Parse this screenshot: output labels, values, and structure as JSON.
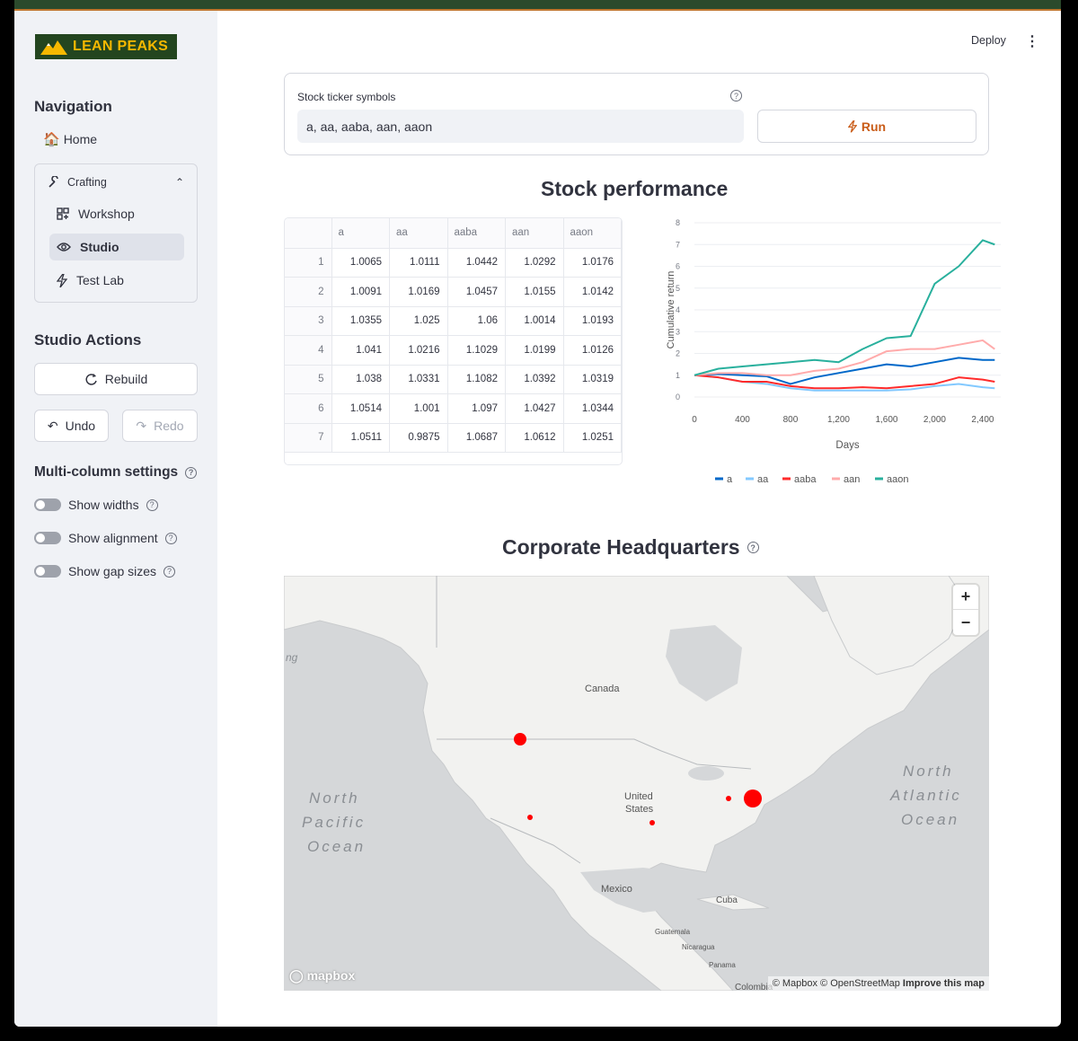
{
  "app": {
    "logo_text": "LEAN PEAKS",
    "deploy_label": "Deploy",
    "menu_icon": "kebab-menu-icon"
  },
  "sidebar": {
    "navigation_title": "Navigation",
    "home_label": "Home",
    "group": {
      "label": "Crafting",
      "items": [
        {
          "label": "Workshop",
          "icon": "grid-plus-icon",
          "active": false
        },
        {
          "label": "Studio",
          "icon": "eye-icon",
          "active": true
        },
        {
          "label": "Test Lab",
          "icon": "bolt-icon",
          "active": false
        }
      ]
    },
    "actions_title": "Studio Actions",
    "rebuild_label": "Rebuild",
    "undo_label": "Undo",
    "redo_label": "Redo",
    "settings_title": "Multi-column settings",
    "toggles": [
      {
        "label": "Show widths",
        "on": false
      },
      {
        "label": "Show alignment",
        "on": false
      },
      {
        "label": "Show gap sizes",
        "on": false
      }
    ]
  },
  "form": {
    "label": "Stock ticker symbols",
    "value": "a, aa, aaba, aan, aaon",
    "run_label": "Run",
    "accent": "#c95c18"
  },
  "performance": {
    "title": "Stock performance",
    "columns": [
      "a",
      "aa",
      "aaba",
      "aan",
      "aaon"
    ],
    "rows": [
      [
        "1",
        "1.0065",
        "1.0111",
        "1.0442",
        "1.0292",
        "1.0176"
      ],
      [
        "2",
        "1.0091",
        "1.0169",
        "1.0457",
        "1.0155",
        "1.0142"
      ],
      [
        "3",
        "1.0355",
        "1.025",
        "1.06",
        "1.0014",
        "1.0193"
      ],
      [
        "4",
        "1.041",
        "1.0216",
        "1.1029",
        "1.0199",
        "1.0126"
      ],
      [
        "5",
        "1.038",
        "1.0331",
        "1.1082",
        "1.0392",
        "1.0319"
      ],
      [
        "6",
        "1.0514",
        "1.001",
        "1.097",
        "1.0427",
        "1.0344"
      ],
      [
        "7",
        "1.0511",
        "0.9875",
        "1.0687",
        "1.0612",
        "1.0251"
      ]
    ]
  },
  "chart_data": {
    "type": "line",
    "xlabel": "Days",
    "ylabel": "Cumulative return",
    "xlim": [
      0,
      2550
    ],
    "ylim": [
      0,
      8
    ],
    "x_ticks": [
      0,
      400,
      800,
      1200,
      1600,
      2000,
      2400
    ],
    "x_tick_labels": [
      "0",
      "400",
      "800",
      "1,200",
      "1,600",
      "2,000",
      "2,400"
    ],
    "y_ticks": [
      0,
      1,
      2,
      3,
      4,
      5,
      6,
      7,
      8
    ],
    "grid": true,
    "legend_position": "bottom",
    "x": [
      0,
      200,
      400,
      600,
      800,
      1000,
      1200,
      1400,
      1600,
      1800,
      2000,
      2200,
      2400,
      2500
    ],
    "series": [
      {
        "name": "a",
        "color": "#0068c9",
        "values": [
          1.0,
          1.05,
          1.0,
          0.95,
          0.6,
          0.9,
          1.1,
          1.3,
          1.5,
          1.4,
          1.6,
          1.8,
          1.7,
          1.7
        ]
      },
      {
        "name": "aa",
        "color": "#83c9ff",
        "values": [
          1.0,
          0.9,
          0.7,
          0.6,
          0.4,
          0.3,
          0.3,
          0.3,
          0.3,
          0.35,
          0.5,
          0.6,
          0.45,
          0.4
        ]
      },
      {
        "name": "aaba",
        "color": "#ff2b2b",
        "values": [
          1.0,
          0.9,
          0.7,
          0.7,
          0.5,
          0.4,
          0.4,
          0.45,
          0.4,
          0.5,
          0.6,
          0.9,
          0.8,
          0.7
        ]
      },
      {
        "name": "aan",
        "color": "#ffabab",
        "values": [
          1.0,
          1.1,
          1.1,
          1.0,
          1.0,
          1.2,
          1.3,
          1.6,
          2.1,
          2.2,
          2.2,
          2.4,
          2.6,
          2.2
        ]
      },
      {
        "name": "aaon",
        "color": "#29b09d",
        "values": [
          1.0,
          1.3,
          1.4,
          1.5,
          1.6,
          1.7,
          1.6,
          2.2,
          2.7,
          2.8,
          5.2,
          6.0,
          7.2,
          7.0
        ]
      }
    ]
  },
  "map": {
    "title": "Corporate Headquarters",
    "labels": {
      "canada": "Canada",
      "united_states_1": "United",
      "united_states_2": "States",
      "mexico": "Mexico",
      "cuba": "Cuba",
      "guatemala": "Guatemala",
      "nicaragua": "Nicaragua",
      "panama": "Panama",
      "colombia": "Colombia",
      "north_pacific_1": "North",
      "north_pacific_2": "Pacific",
      "north_pacific_3": "Ocean",
      "north_atlantic_1": "North",
      "north_atlantic_2": "Atlantic",
      "north_atlantic_3": "Ocean",
      "partial_left": "ng"
    },
    "zoom_in": "+",
    "zoom_out": "−",
    "mapbox_logo": "mapbox",
    "attribution": "© Mapbox © OpenStreetMap",
    "improve": "Improve this map"
  }
}
